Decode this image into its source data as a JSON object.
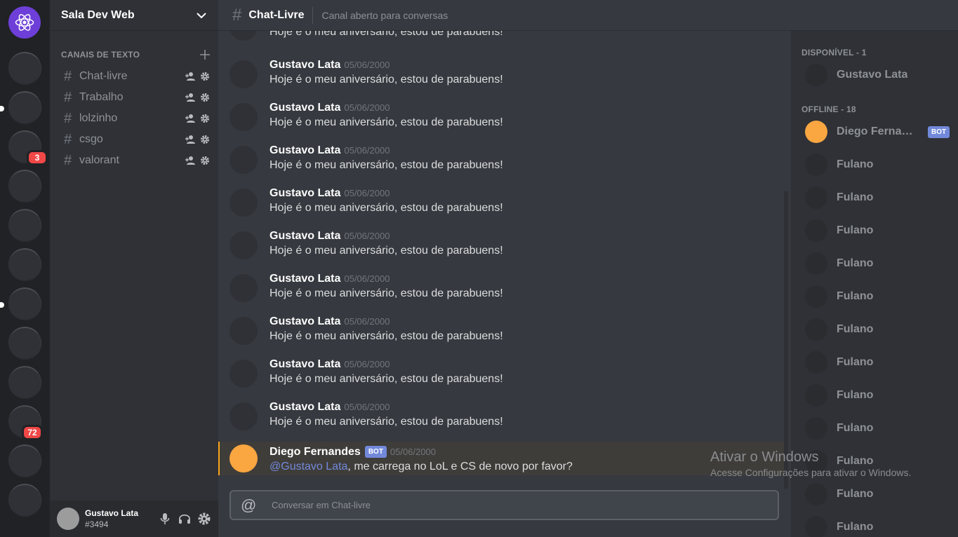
{
  "server": {
    "name": "Sala Dev Web",
    "badges": [
      "3",
      "72"
    ]
  },
  "channels": {
    "category": "CANAIS DE TEXTO",
    "items": [
      "Chat-livre",
      "Trabalho",
      "lolzinho",
      "csgo",
      "valorant"
    ]
  },
  "user": {
    "name": "Gustavo Lata",
    "tag": "#3494"
  },
  "chat": {
    "title": "Chat-Livre",
    "topic": "Canal aberto para conversas",
    "composer_placeholder": "Conversar em Chat-livre",
    "messages": [
      {
        "author": "",
        "date": "",
        "text": "Hoje é o meu aniversário, estou de parabuens!"
      },
      {
        "author": "Gustavo Lata",
        "date": "05/06/2000",
        "text": "Hoje é o meu aniversário, estou de parabuens!"
      },
      {
        "author": "Gustavo Lata",
        "date": "05/06/2000",
        "text": "Hoje é o meu aniversário, estou de parabuens!"
      },
      {
        "author": "Gustavo Lata",
        "date": "05/06/2000",
        "text": "Hoje é o meu aniversário, estou de parabuens!"
      },
      {
        "author": "Gustavo Lata",
        "date": "05/06/2000",
        "text": "Hoje é o meu aniversário, estou de parabuens!"
      },
      {
        "author": "Gustavo Lata",
        "date": "05/06/2000",
        "text": "Hoje é o meu aniversário, estou de parabuens!"
      },
      {
        "author": "Gustavo Lata",
        "date": "05/06/2000",
        "text": "Hoje é o meu aniversário, estou de parabuens!"
      },
      {
        "author": "Gustavo Lata",
        "date": "05/06/2000",
        "text": "Hoje é o meu aniversário, estou de parabuens!"
      },
      {
        "author": "Gustavo Lata",
        "date": "05/06/2000",
        "text": "Hoje é o meu aniversário, estou de parabuens!"
      },
      {
        "author": "Gustavo Lata",
        "date": "05/06/2000",
        "text": "Hoje é o meu aniversário, estou de parabuens!"
      }
    ],
    "mention_message": {
      "author": "Diego Fernandes",
      "bot": "BOT",
      "date": "05/06/2000",
      "mention": "@Gustavo Lata",
      "text": ", me carrega no LoL e CS de novo por favor?"
    }
  },
  "members": {
    "online_label": "DISPONÍVEL - 1",
    "online": [
      "Gustavo Lata"
    ],
    "offline_label": "OFFLINE - 18",
    "bot": {
      "name": "Diego Fernandes",
      "tag": "BOT"
    },
    "offline": [
      "Fulano",
      "Fulano",
      "Fulano",
      "Fulano",
      "Fulano",
      "Fulano",
      "Fulano",
      "Fulano",
      "Fulano",
      "Fulano",
      "Fulano",
      "Fulano"
    ]
  },
  "watermark": {
    "title": "Ativar o Windows",
    "subtitle": "Acesse Configurações para ativar o Windows."
  },
  "colors": {
    "accent": "#7289da",
    "home": "#6e3fd8",
    "mention_bar": "#faa61a",
    "badge": "#f04747",
    "bot_avatar": "#faa61a"
  }
}
